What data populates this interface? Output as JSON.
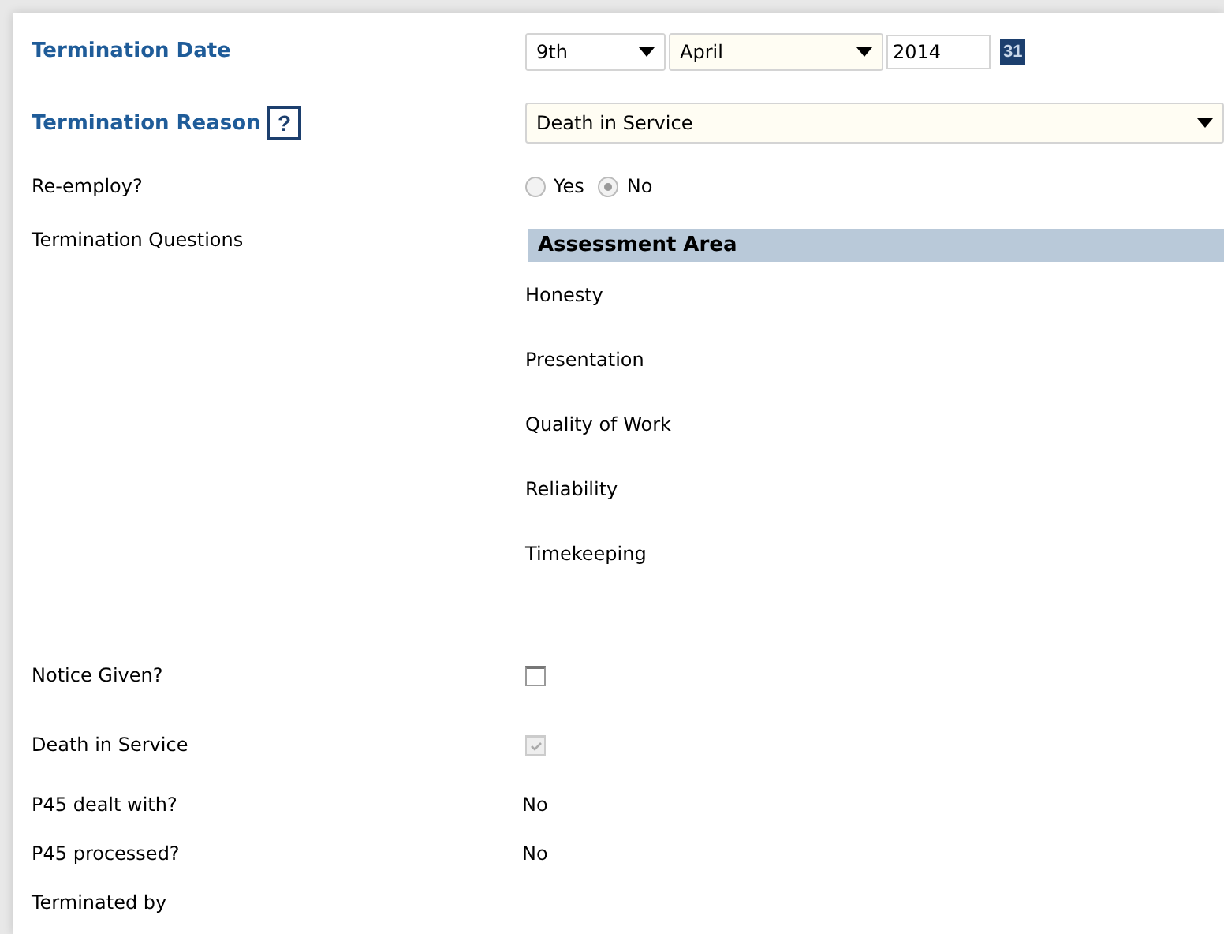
{
  "termination_date": {
    "label": "Termination Date",
    "day": "9th",
    "month": "April",
    "year": "2014",
    "calendar_icon": "31"
  },
  "termination_reason": {
    "label": "Termination Reason",
    "help": "?",
    "value": "Death in Service"
  },
  "re_employ": {
    "label": "Re-employ?",
    "options": [
      {
        "label": "Yes",
        "selected": false
      },
      {
        "label": "No",
        "selected": true
      }
    ]
  },
  "termination_questions": {
    "label": "Termination Questions",
    "header": "Assessment Area",
    "items": [
      "Honesty",
      "Presentation",
      "Quality of Work",
      "Reliability",
      "Timekeeping"
    ]
  },
  "checks": [
    {
      "label": "Notice Given?",
      "checked": false,
      "disabled": false
    },
    {
      "label": "Death in Service",
      "checked": true,
      "disabled": true
    }
  ],
  "info": [
    {
      "label": "P45 dealt with?",
      "value": "No"
    },
    {
      "label": "P45 processed?",
      "value": "No"
    },
    {
      "label": "Terminated by"
    }
  ]
}
